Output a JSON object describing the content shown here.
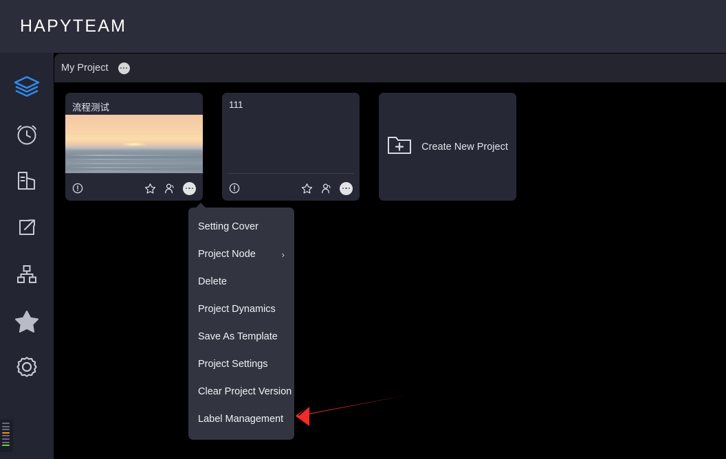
{
  "header": {
    "brand": "HAPYTEAM"
  },
  "sidebar": {
    "items": [
      {
        "name": "layers-icon",
        "label": "Layers",
        "active": true
      },
      {
        "name": "alarm-clock-icon",
        "label": "Schedule",
        "active": false
      },
      {
        "name": "building-chart-icon",
        "label": "Reports",
        "active": false
      },
      {
        "name": "share-export-icon",
        "label": "Share",
        "active": false
      },
      {
        "name": "org-chart-icon",
        "label": "Organization",
        "active": false
      },
      {
        "name": "star-icon",
        "label": "Favorites",
        "active": false
      },
      {
        "name": "gear-icon",
        "label": "Settings",
        "active": false
      }
    ],
    "active_color": "#2e8cf0",
    "inactive_color": "#c9cbd4"
  },
  "project_bar": {
    "title": "My Project",
    "more_icon": "ellipsis-icon"
  },
  "cards": [
    {
      "title": "流程测试",
      "has_cover": true,
      "cover_description": "sunset over ocean photograph",
      "info_icon": "info-icon",
      "star_icon": "star-outline-icon",
      "members_icon": "members-icon",
      "more_icon": "ellipsis-icon",
      "menu_open": true
    },
    {
      "title": "111",
      "has_cover": false,
      "info_icon": "info-icon",
      "star_icon": "star-outline-icon",
      "members_icon": "members-icon",
      "more_icon": "ellipsis-icon",
      "menu_open": false
    }
  ],
  "create_card": {
    "label": "Create New Project",
    "icon": "folder-plus-icon"
  },
  "context_menu": {
    "items": [
      {
        "label": "Setting Cover",
        "submenu": false
      },
      {
        "label": "Project Node",
        "submenu": true,
        "chevron": "›"
      },
      {
        "label": "Delete",
        "submenu": false
      },
      {
        "label": "Project Dynamics",
        "submenu": false
      },
      {
        "label": "Save As Template",
        "submenu": false
      },
      {
        "label": "Project Settings",
        "submenu": false
      },
      {
        "label": "Clear Project Version",
        "submenu": false
      },
      {
        "label": "Label Management",
        "submenu": false
      }
    ]
  },
  "annotation": {
    "type": "arrow",
    "color": "#f22a2a",
    "points_to": "Label Management"
  },
  "colors": {
    "header_bg": "#2c2d3a",
    "sidebar_bg": "#242532",
    "content_bg": "#000000",
    "card_bg": "#272836",
    "menu_bg": "#32343f",
    "accent_blue": "#2e8cf0",
    "text_primary": "#f0f1f5"
  }
}
